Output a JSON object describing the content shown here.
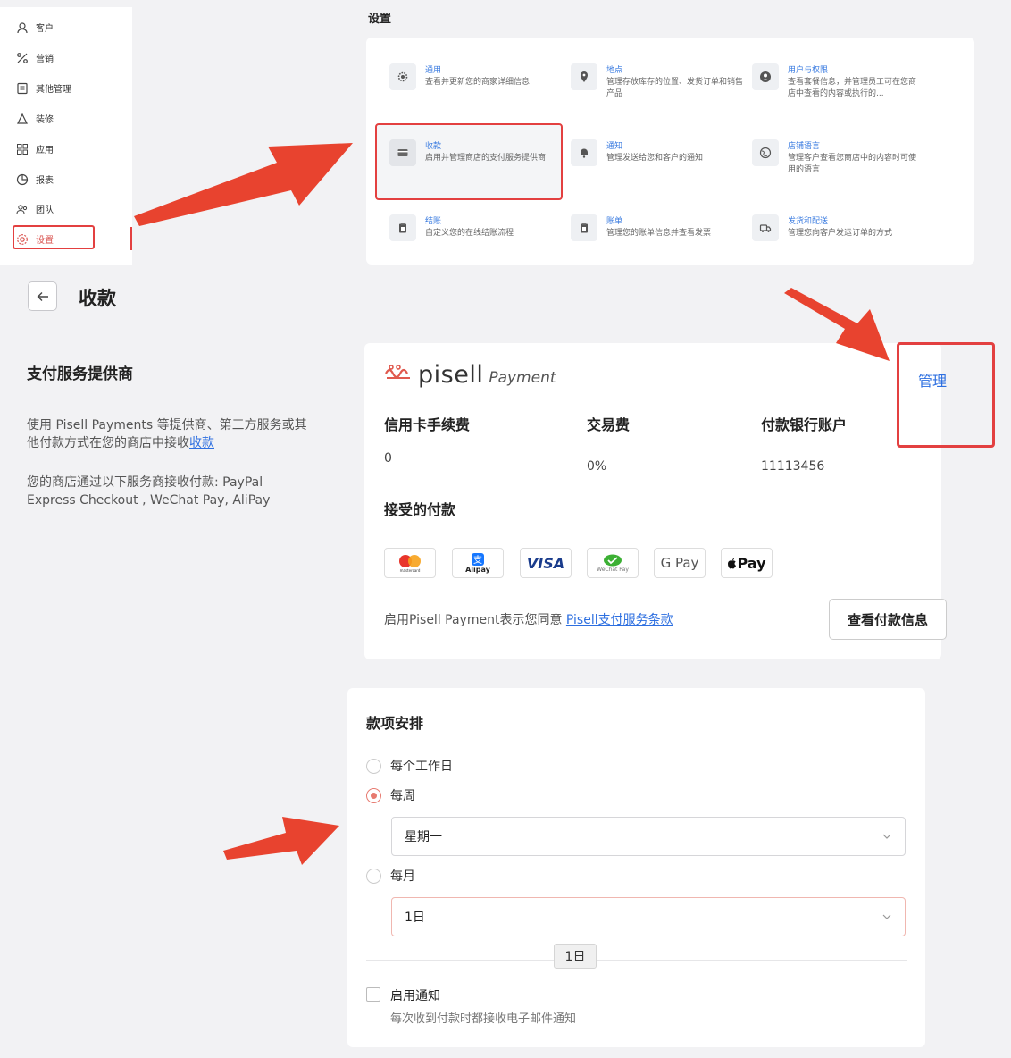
{
  "sidebar": {
    "items": [
      {
        "label": "客户",
        "icon": "user-icon"
      },
      {
        "label": "营销",
        "icon": "percent-icon"
      },
      {
        "label": "其他管理",
        "icon": "document-icon"
      },
      {
        "label": "装修",
        "icon": "brush-icon"
      },
      {
        "label": "应用",
        "icon": "grid-icon"
      },
      {
        "label": "报表",
        "icon": "chart-icon"
      },
      {
        "label": "团队",
        "icon": "team-icon"
      },
      {
        "label": "设置",
        "icon": "gear-icon"
      }
    ]
  },
  "settings": {
    "title": "设置",
    "items": [
      {
        "title": "通用",
        "desc": "查看并更新您的商家详细信息",
        "icon": "gear-icon"
      },
      {
        "title": "地点",
        "desc": "管理存放库存的位置、发货订单和销售产品",
        "icon": "location-icon"
      },
      {
        "title": "用户与权限",
        "desc": "查看套餐信息，并管理员工可在您商店中查看的内容或执行的...",
        "icon": "user-circle-icon"
      },
      {
        "title": "收款",
        "desc": "启用并管理商店的支付服务提供商",
        "icon": "card-icon"
      },
      {
        "title": "通知",
        "desc": "管理发送给您和客户的通知",
        "icon": "bell-icon"
      },
      {
        "title": "店铺语言",
        "desc": "管理客户查看您商店中的内容时可使用的语言",
        "icon": "globe-icon"
      },
      {
        "title": "结账",
        "desc": "自定义您的在线结账流程",
        "icon": "clipboard-icon"
      },
      {
        "title": "账单",
        "desc": "管理您的账单信息并查看发票",
        "icon": "bill-icon"
      },
      {
        "title": "发货和配送",
        "desc": "管理您向客户发运订单的方式",
        "icon": "truck-icon"
      }
    ]
  },
  "header": {
    "title": "收款"
  },
  "provider": {
    "title": "支付服务提供商",
    "desc_prefix": "使用 Pisell Payments 等提供商、第三方服务或其他付款方式在您的商店中接收",
    "desc_link": "收款",
    "desc2": "您的商店通过以下服务商接收付款: PayPal Express Checkout , WeChat Pay, AliPay"
  },
  "payment_card": {
    "brand": "pisell",
    "brand_sub": "Payment",
    "manage_label": "管理",
    "fees": [
      {
        "label": "信用卡手续费",
        "value": "0"
      },
      {
        "label": "交易费",
        "value": "0%"
      },
      {
        "label": "付款银行账户",
        "value": "11113456"
      }
    ],
    "accept_title": "接受的付款",
    "methods": [
      {
        "label": "mastercard",
        "icon": "mastercard-icon"
      },
      {
        "label": "Alipay",
        "icon": "alipay-icon"
      },
      {
        "label": "VISA",
        "icon": "visa-icon"
      },
      {
        "label": "WeChat Pay",
        "icon": "wechat-pay-icon"
      },
      {
        "label": "G Pay",
        "icon": "google-pay-icon"
      },
      {
        "label": "Pay",
        "icon": "apple-pay-icon"
      }
    ],
    "agree_text": "启用Pisell Payment表示您同意 ",
    "agree_link": "Pisell支付服务条款",
    "view_button": "查看付款信息"
  },
  "schedule": {
    "title": "款项安排",
    "options": [
      {
        "label": "每个工作日",
        "selected": false
      },
      {
        "label": "每周",
        "selected": true
      },
      {
        "label": "每月",
        "selected": false
      }
    ],
    "weekly_value": "星期一",
    "monthly_value": "1日",
    "tooltip": "1日",
    "notify_label": "启用通知",
    "notify_desc": "每次收到付款时都接收电子邮件通知",
    "notify_checked": false
  },
  "colors": {
    "accent": "#2d6fe0",
    "highlight": "#e34040",
    "radio": "#e77a70"
  }
}
